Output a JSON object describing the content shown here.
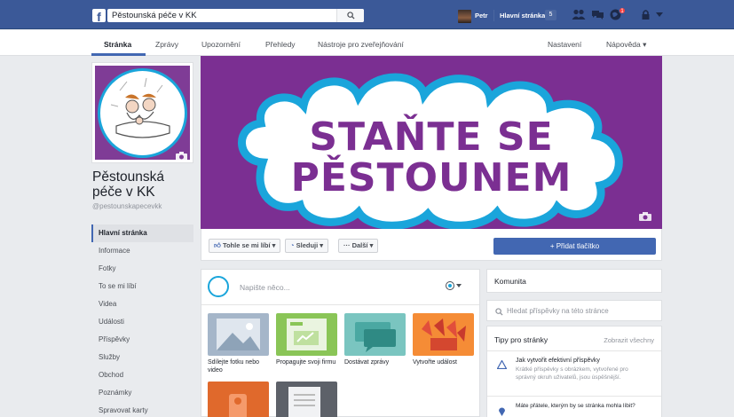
{
  "topbar": {
    "search_value": "Pěstounská péče v KK",
    "user_name": "Petr",
    "home_label": "Hlavní stránka",
    "home_count": "5",
    "notifications_count": "1"
  },
  "pagenav": {
    "tabs": [
      {
        "label": "Stránka"
      },
      {
        "label": "Zprávy"
      },
      {
        "label": "Upozornění"
      },
      {
        "label": "Přehledy"
      },
      {
        "label": "Nástroje pro zveřejňování"
      }
    ],
    "settings_label": "Nastavení",
    "help_label": "Nápověda ▾"
  },
  "page": {
    "name": "Pěstounská péče v KK",
    "handle": "@pestounskapecevkk"
  },
  "sidebar": {
    "items": [
      {
        "label": "Hlavní stránka"
      },
      {
        "label": "Informace"
      },
      {
        "label": "Fotky"
      },
      {
        "label": "To se mi líbí"
      },
      {
        "label": "Videa"
      },
      {
        "label": "Události"
      },
      {
        "label": "Příspěvky"
      },
      {
        "label": "Služby"
      },
      {
        "label": "Obchod"
      },
      {
        "label": "Poznámky"
      },
      {
        "label": "Spravovat karty"
      }
    ]
  },
  "cover": {
    "line1": "STAŇTE SE",
    "line2": "PĚSTOUNEM"
  },
  "actions": {
    "like_label": "Tohle se mi líbí ▾",
    "follow_label": "Sleduji ▾",
    "more_label": "··· Další ▾",
    "add_button_label": "+ Přidat tlačítko"
  },
  "composer": {
    "placeholder": "Napište něco...",
    "tiles": [
      {
        "label": "Sdílejte fotku nebo video"
      },
      {
        "label": "Propagujte svoji firmu"
      },
      {
        "label": "Dostávat zprávy"
      },
      {
        "label": "Vytvořte událost"
      }
    ]
  },
  "right": {
    "community_title": "Komunita",
    "search_placeholder": "Hledat příspěvky na této stránce",
    "tips_title": "Tipy pro stránky",
    "tips_link": "Zobrazit všechny",
    "tip1_title": "Jak vytvořit efektivní příspěvky",
    "tip1_desc": "Krátké příspěvky s obrázkem, vytvořené pro správný okruh uživatelů, jsou úspěšnější.",
    "tip2_title": "Máte přátele, kterým by se stránka mohla líbit?"
  },
  "colors": {
    "facebook_blue": "#3b5998",
    "button_blue": "#4267b2",
    "cover_purple": "#7b2f92",
    "cloud_blue": "#1aa5db"
  }
}
